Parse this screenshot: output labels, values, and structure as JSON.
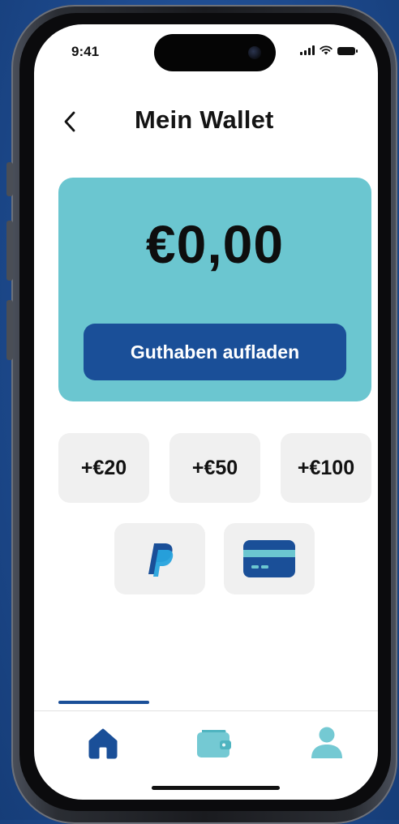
{
  "status_bar": {
    "time": "9:41"
  },
  "header": {
    "title": "Mein Wallet",
    "back_icon": "chevron-left-icon"
  },
  "balance": {
    "amount": "€0,00",
    "topup_label": "Guthaben aufladen"
  },
  "amount_options": [
    {
      "label": "+€20"
    },
    {
      "label": "+€50"
    },
    {
      "label": "+€100"
    }
  ],
  "payment_methods": [
    {
      "icon": "paypal-icon"
    },
    {
      "icon": "credit-card-icon"
    }
  ],
  "tab_bar": {
    "tabs": [
      {
        "icon": "home-icon",
        "active": true
      },
      {
        "icon": "wallet-icon",
        "active": false
      },
      {
        "icon": "profile-icon",
        "active": false
      }
    ]
  },
  "colors": {
    "accent": "#1a4f98",
    "card": "#6bc6d0",
    "chip": "#f0f0f0",
    "inactive_icon": "#74c9d3"
  }
}
